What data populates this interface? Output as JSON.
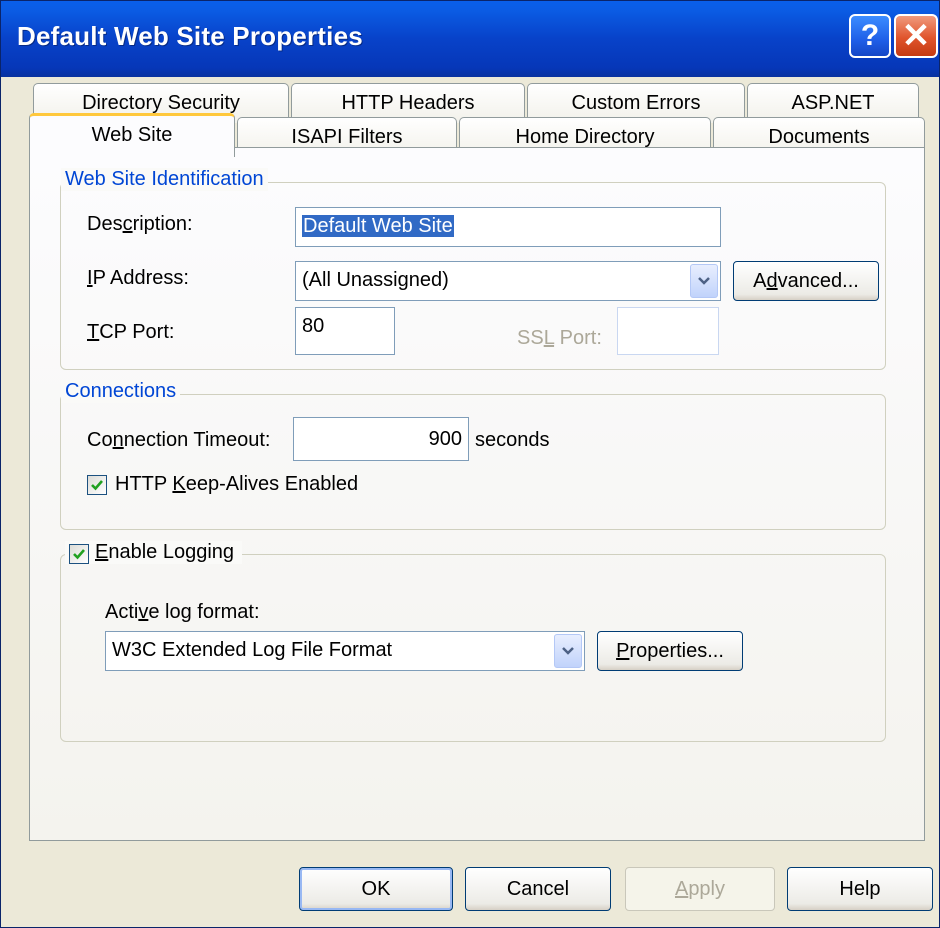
{
  "window": {
    "title": "Default Web Site Properties",
    "help_glyph": "?",
    "close_glyph": "✕"
  },
  "tabs": {
    "row_back": [
      "Directory Security",
      "HTTP Headers",
      "Custom Errors",
      "ASP.NET"
    ],
    "row_front": [
      "Web Site",
      "ISAPI Filters",
      "Home Directory",
      "Documents"
    ],
    "active": "Web Site"
  },
  "identification": {
    "legend": "Web Site Identification",
    "description_label": [
      "Des",
      "c",
      "ription:"
    ],
    "description_value": "Default Web Site",
    "ip_label": [
      "",
      "I",
      "P Address:"
    ],
    "ip_value": "(All Unassigned)",
    "advanced_label": [
      "A",
      "d",
      "vanced..."
    ],
    "tcp_label": [
      "",
      "T",
      "CP Port:"
    ],
    "tcp_value": "80",
    "ssl_label": [
      "SS",
      "L",
      " Port:"
    ],
    "ssl_value": ""
  },
  "connections": {
    "legend": "Connections",
    "timeout_label": [
      "Co",
      "n",
      "nection Timeout:"
    ],
    "timeout_value": "900",
    "timeout_unit": "seconds",
    "keepalive_label": [
      "HTTP ",
      "K",
      "eep-Alives Enabled"
    ],
    "keepalive_checked": true
  },
  "logging": {
    "enable_label": [
      "",
      "E",
      "nable Logging"
    ],
    "enable_checked": true,
    "format_label": [
      "Acti",
      "v",
      "e log format:"
    ],
    "format_value": "W3C Extended Log File Format",
    "properties_label": [
      "",
      "P",
      "roperties..."
    ]
  },
  "buttons": {
    "ok": "OK",
    "cancel": "Cancel",
    "apply": [
      "",
      "A",
      "pply"
    ],
    "help": "Help"
  },
  "colors": {
    "titlebar": "#0842C9",
    "legend_text": "#0046D5",
    "selection": "#316AC5",
    "active_tab_highlight": "#FFC83C",
    "check_mark": "#21A121"
  }
}
